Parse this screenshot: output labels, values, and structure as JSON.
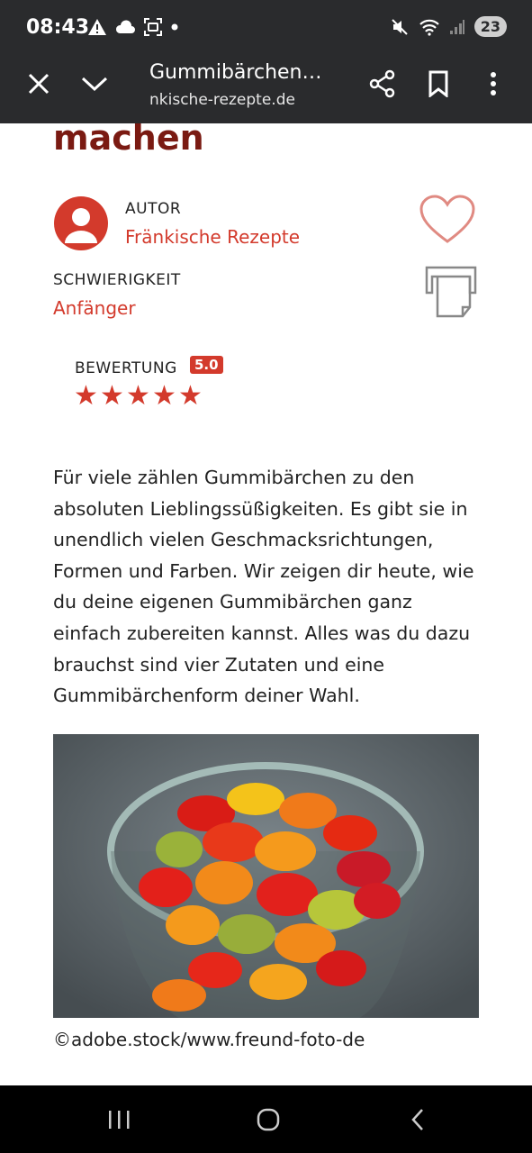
{
  "status_bar": {
    "time": "08:43",
    "battery": "23",
    "left_icons": [
      "warning-icon",
      "cloud-icon",
      "screenshot-icon",
      "dot-icon"
    ],
    "right_icons": [
      "mute-icon",
      "wifi-icon",
      "signal-icon"
    ]
  },
  "toolbar": {
    "title": "Gummibärchen…",
    "url": "nkische-rezepte.de",
    "close_icon": "close-icon",
    "collapse_icon": "chevron-down-icon",
    "share_icon": "share-icon",
    "bookmark_icon": "bookmark-icon",
    "menu_icon": "more-vert-icon"
  },
  "article": {
    "headline_fragment": "machen",
    "author_label": "AUTOR",
    "author_name": "Fränkische Rezepte",
    "difficulty_label": "SCHWIERIGKEIT",
    "difficulty_value": "Anfänger",
    "rating_label": "BEWERTUNG",
    "rating_value": "5.0",
    "rating_stars": 5,
    "intro": "Für viele zählen Gummibärchen zu den absoluten Lieblingssüßigkeiten. Es gibt sie in unendlich vielen Geschmacksrichtungen, Formen und Farben. Wir zeigen dir heute, wie du deine eigenen Gummibärchen ganz einfach zubereiten kannst. Alles was du dazu brauchst sind vier Zutaten und eine Gummibärchenform deiner Wahl.",
    "image_caption": "©adobe.stock/www.freund-foto-de"
  },
  "colors": {
    "accent": "#d33a2c",
    "headline": "#7a1a12",
    "chrome": "#2a2b2d"
  },
  "nav_bar": {
    "recents_icon": "recents-icon",
    "home_icon": "home-icon",
    "back_icon": "back-icon"
  }
}
